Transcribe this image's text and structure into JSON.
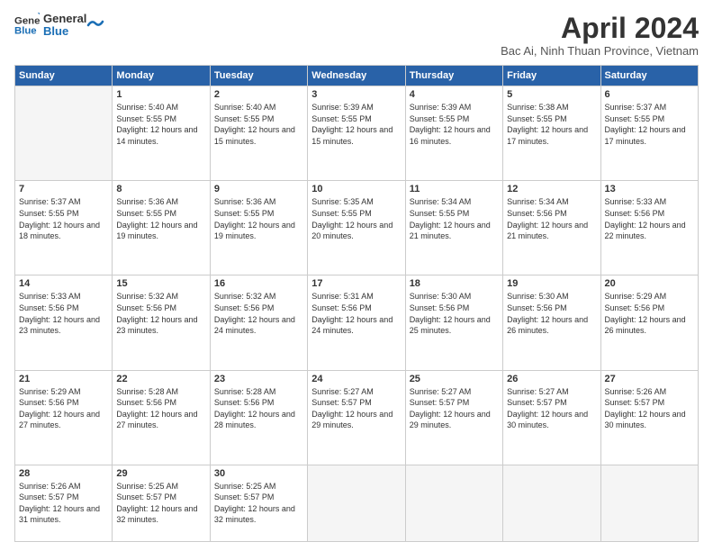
{
  "logo": {
    "line1": "General",
    "line2": "Blue"
  },
  "title": "April 2024",
  "subtitle": "Bac Ai, Ninh Thuan Province, Vietnam",
  "days_of_week": [
    "Sunday",
    "Monday",
    "Tuesday",
    "Wednesday",
    "Thursday",
    "Friday",
    "Saturday"
  ],
  "weeks": [
    [
      {
        "day": "",
        "info": ""
      },
      {
        "day": "1",
        "info": "Sunrise: 5:40 AM\nSunset: 5:55 PM\nDaylight: 12 hours\nand 14 minutes."
      },
      {
        "day": "2",
        "info": "Sunrise: 5:40 AM\nSunset: 5:55 PM\nDaylight: 12 hours\nand 15 minutes."
      },
      {
        "day": "3",
        "info": "Sunrise: 5:39 AM\nSunset: 5:55 PM\nDaylight: 12 hours\nand 15 minutes."
      },
      {
        "day": "4",
        "info": "Sunrise: 5:39 AM\nSunset: 5:55 PM\nDaylight: 12 hours\nand 16 minutes."
      },
      {
        "day": "5",
        "info": "Sunrise: 5:38 AM\nSunset: 5:55 PM\nDaylight: 12 hours\nand 17 minutes."
      },
      {
        "day": "6",
        "info": "Sunrise: 5:37 AM\nSunset: 5:55 PM\nDaylight: 12 hours\nand 17 minutes."
      }
    ],
    [
      {
        "day": "7",
        "info": "Sunrise: 5:37 AM\nSunset: 5:55 PM\nDaylight: 12 hours\nand 18 minutes."
      },
      {
        "day": "8",
        "info": "Sunrise: 5:36 AM\nSunset: 5:55 PM\nDaylight: 12 hours\nand 19 minutes."
      },
      {
        "day": "9",
        "info": "Sunrise: 5:36 AM\nSunset: 5:55 PM\nDaylight: 12 hours\nand 19 minutes."
      },
      {
        "day": "10",
        "info": "Sunrise: 5:35 AM\nSunset: 5:55 PM\nDaylight: 12 hours\nand 20 minutes."
      },
      {
        "day": "11",
        "info": "Sunrise: 5:34 AM\nSunset: 5:55 PM\nDaylight: 12 hours\nand 21 minutes."
      },
      {
        "day": "12",
        "info": "Sunrise: 5:34 AM\nSunset: 5:56 PM\nDaylight: 12 hours\nand 21 minutes."
      },
      {
        "day": "13",
        "info": "Sunrise: 5:33 AM\nSunset: 5:56 PM\nDaylight: 12 hours\nand 22 minutes."
      }
    ],
    [
      {
        "day": "14",
        "info": "Sunrise: 5:33 AM\nSunset: 5:56 PM\nDaylight: 12 hours\nand 23 minutes."
      },
      {
        "day": "15",
        "info": "Sunrise: 5:32 AM\nSunset: 5:56 PM\nDaylight: 12 hours\nand 23 minutes."
      },
      {
        "day": "16",
        "info": "Sunrise: 5:32 AM\nSunset: 5:56 PM\nDaylight: 12 hours\nand 24 minutes."
      },
      {
        "day": "17",
        "info": "Sunrise: 5:31 AM\nSunset: 5:56 PM\nDaylight: 12 hours\nand 24 minutes."
      },
      {
        "day": "18",
        "info": "Sunrise: 5:30 AM\nSunset: 5:56 PM\nDaylight: 12 hours\nand 25 minutes."
      },
      {
        "day": "19",
        "info": "Sunrise: 5:30 AM\nSunset: 5:56 PM\nDaylight: 12 hours\nand 26 minutes."
      },
      {
        "day": "20",
        "info": "Sunrise: 5:29 AM\nSunset: 5:56 PM\nDaylight: 12 hours\nand 26 minutes."
      }
    ],
    [
      {
        "day": "21",
        "info": "Sunrise: 5:29 AM\nSunset: 5:56 PM\nDaylight: 12 hours\nand 27 minutes."
      },
      {
        "day": "22",
        "info": "Sunrise: 5:28 AM\nSunset: 5:56 PM\nDaylight: 12 hours\nand 27 minutes."
      },
      {
        "day": "23",
        "info": "Sunrise: 5:28 AM\nSunset: 5:56 PM\nDaylight: 12 hours\nand 28 minutes."
      },
      {
        "day": "24",
        "info": "Sunrise: 5:27 AM\nSunset: 5:57 PM\nDaylight: 12 hours\nand 29 minutes."
      },
      {
        "day": "25",
        "info": "Sunrise: 5:27 AM\nSunset: 5:57 PM\nDaylight: 12 hours\nand 29 minutes."
      },
      {
        "day": "26",
        "info": "Sunrise: 5:27 AM\nSunset: 5:57 PM\nDaylight: 12 hours\nand 30 minutes."
      },
      {
        "day": "27",
        "info": "Sunrise: 5:26 AM\nSunset: 5:57 PM\nDaylight: 12 hours\nand 30 minutes."
      }
    ],
    [
      {
        "day": "28",
        "info": "Sunrise: 5:26 AM\nSunset: 5:57 PM\nDaylight: 12 hours\nand 31 minutes."
      },
      {
        "day": "29",
        "info": "Sunrise: 5:25 AM\nSunset: 5:57 PM\nDaylight: 12 hours\nand 32 minutes."
      },
      {
        "day": "30",
        "info": "Sunrise: 5:25 AM\nSunset: 5:57 PM\nDaylight: 12 hours\nand 32 minutes."
      },
      {
        "day": "",
        "info": ""
      },
      {
        "day": "",
        "info": ""
      },
      {
        "day": "",
        "info": ""
      },
      {
        "day": "",
        "info": ""
      }
    ]
  ]
}
